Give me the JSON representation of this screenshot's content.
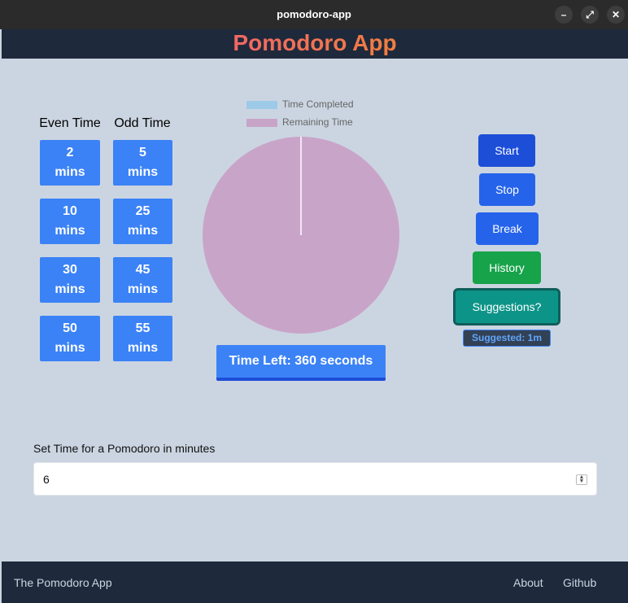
{
  "window": {
    "title": "pomodoro-app",
    "minimize_glyph": "–",
    "maximize_glyph": "⤢",
    "close_glyph": "✕"
  },
  "header": {
    "title": "Pomodoro App"
  },
  "presets": {
    "even_heading": "Even Time",
    "odd_heading": "Odd Time",
    "even": [
      {
        "value": "2",
        "unit": "mins"
      },
      {
        "value": "10",
        "unit": "mins"
      },
      {
        "value": "30",
        "unit": "mins"
      },
      {
        "value": "50",
        "unit": "mins"
      }
    ],
    "odd": [
      {
        "value": "5",
        "unit": "mins"
      },
      {
        "value": "25",
        "unit": "mins"
      },
      {
        "value": "45",
        "unit": "mins"
      },
      {
        "value": "55",
        "unit": "mins"
      }
    ]
  },
  "chart_data": {
    "type": "pie",
    "labels": [
      "Time Completed",
      "Remaining Time"
    ],
    "values": [
      0,
      360
    ],
    "colors": [
      "#9ecae9",
      "#c9a4c9"
    ],
    "legend_position": "top"
  },
  "timer": {
    "time_left": "Time Left: 360 seconds"
  },
  "actions": {
    "start": "Start",
    "stop": "Stop",
    "break": "Break",
    "history": "History",
    "suggestions": "Suggestions?",
    "suggested": "Suggested: 1m"
  },
  "settings": {
    "label": "Set Time for a Pomodoro in minutes",
    "value": "6"
  },
  "footer": {
    "brand": "The Pomodoro App",
    "links": [
      "About",
      "Github"
    ]
  },
  "colors": {
    "accent": "#3b82f6",
    "success": "#16a34a",
    "teal": "#0d9488",
    "header_bg": "#1e293b",
    "page_bg": "#cbd5e1"
  }
}
